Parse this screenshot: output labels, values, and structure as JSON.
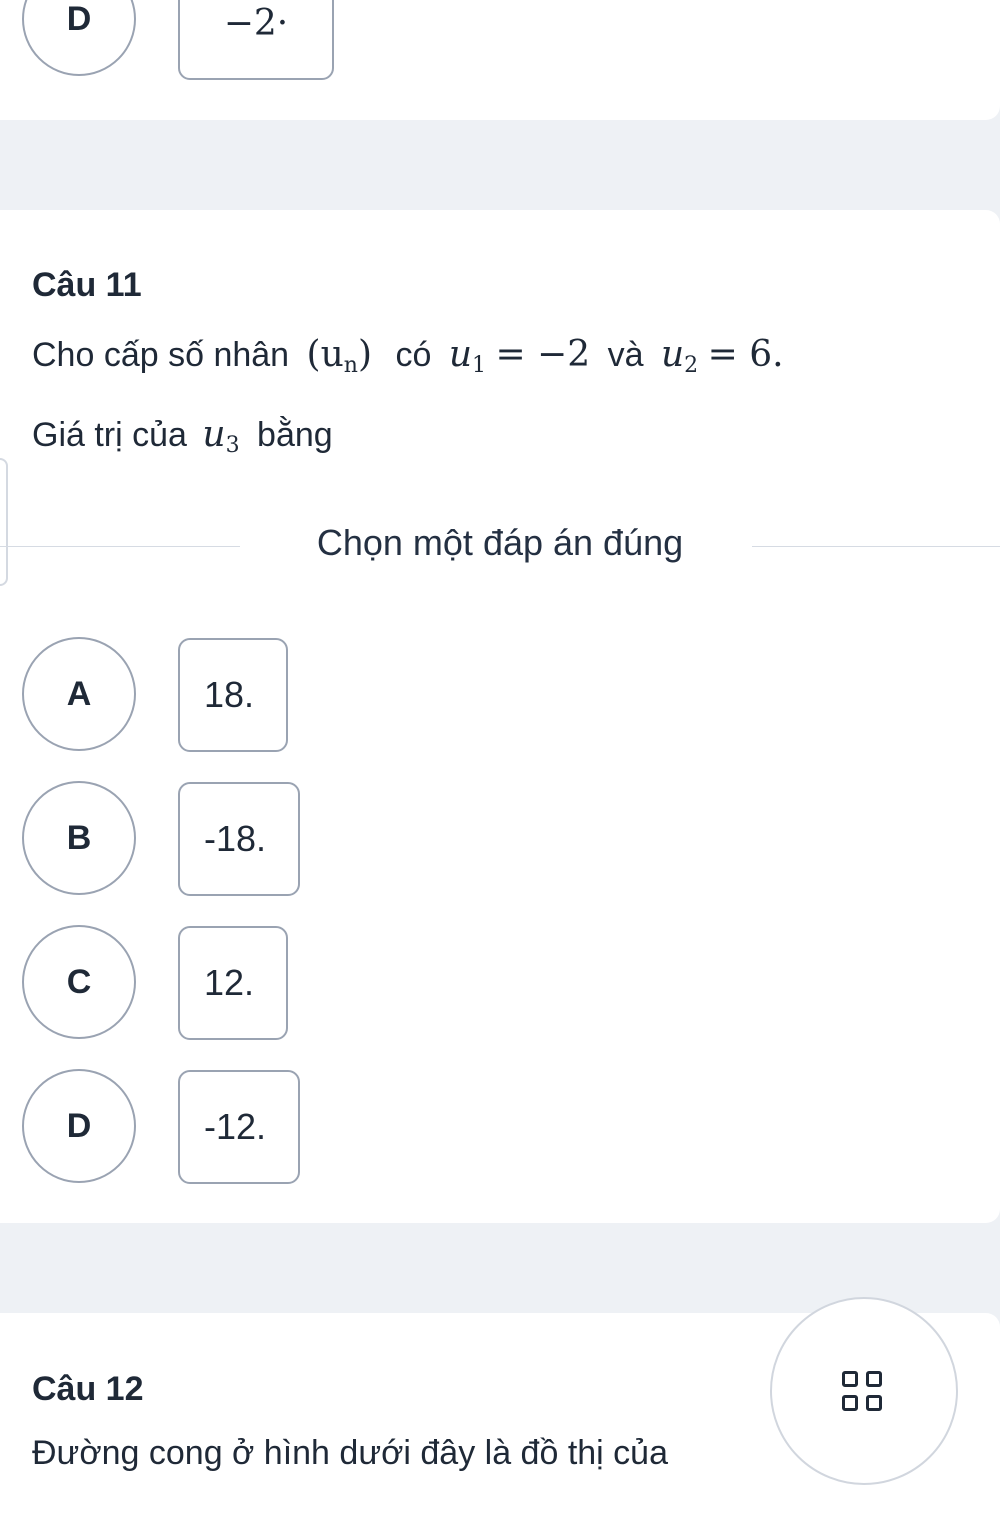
{
  "prev_question": {
    "option_letter": "D",
    "option_value": "−2·"
  },
  "question_11": {
    "title": "Câu 11",
    "line1_text_a": "Cho cấp số nhân",
    "line1_seq": "(u",
    "line1_seq_sub": "n",
    "line1_seq_close": ")",
    "line1_text_b": "có",
    "u1_var": "u",
    "u1_sub": "1",
    "u1_expr": "= −2",
    "line1_text_c": "và",
    "u2_var": "u",
    "u2_sub": "2",
    "u2_expr": "= 6.",
    "line2_text_a": "Giá trị của",
    "u3_var": "u",
    "u3_sub": "3",
    "line2_text_b": "bằng",
    "instruction": "Chọn một đáp án đúng",
    "options": [
      {
        "letter": "A",
        "value": "18."
      },
      {
        "letter": "B",
        "value": "-18."
      },
      {
        "letter": "C",
        "value": "12."
      },
      {
        "letter": "D",
        "value": "-12."
      }
    ]
  },
  "question_12": {
    "title": "Câu 12",
    "text": "Đường cong ở hình dưới đây là đồ thị của"
  },
  "fab": {
    "icon": "grid-icon"
  }
}
